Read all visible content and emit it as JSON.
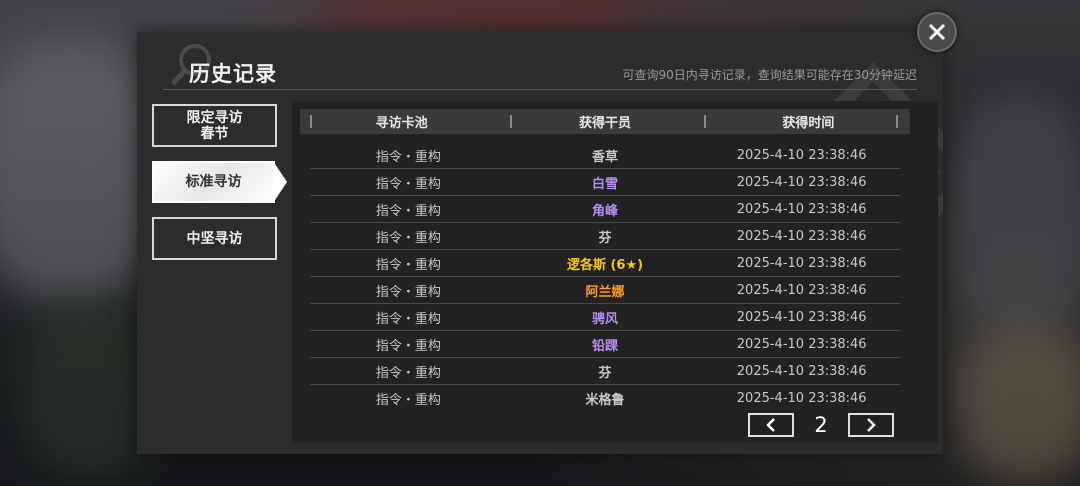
{
  "header": {
    "title": "历史记录",
    "subtitle": "可查询90日内寻访记录，查询结果可能存在30分钟延迟"
  },
  "tabs": [
    {
      "line1": "限定寻访",
      "line2": "春节",
      "active": false
    },
    {
      "label": "标准寻访",
      "active": true
    },
    {
      "label": "中坚寻访",
      "active": false
    }
  ],
  "table": {
    "columns": [
      "寻访卡池",
      "获得干员",
      "获得时间"
    ],
    "rows": [
      {
        "pool": "指令・重构",
        "operator": "香草",
        "time": "2025-4-10 23:38:46",
        "color": "#c8c8c8"
      },
      {
        "pool": "指令・重构",
        "operator": "白雪",
        "time": "2025-4-10 23:38:46",
        "color": "#b58cf0"
      },
      {
        "pool": "指令・重构",
        "operator": "角峰",
        "time": "2025-4-10 23:38:46",
        "color": "#b58cf0"
      },
      {
        "pool": "指令・重构",
        "operator": "芬",
        "time": "2025-4-10 23:38:46",
        "color": "#c8c8c8"
      },
      {
        "pool": "指令・重构",
        "operator": "逻各斯 (6★)",
        "time": "2025-4-10 23:38:46",
        "color": "#f5c518"
      },
      {
        "pool": "指令・重构",
        "operator": "阿兰娜",
        "time": "2025-4-10 23:38:46",
        "color": "#ff9a2a"
      },
      {
        "pool": "指令・重构",
        "operator": "骋风",
        "time": "2025-4-10 23:38:46",
        "color": "#b58cf0"
      },
      {
        "pool": "指令・重构",
        "operator": "铅踝",
        "time": "2025-4-10 23:38:46",
        "color": "#b58cf0"
      },
      {
        "pool": "指令・重构",
        "operator": "芬",
        "time": "2025-4-10 23:38:46",
        "color": "#c8c8c8"
      },
      {
        "pool": "指令・重构",
        "operator": "米格鲁",
        "time": "2025-4-10 23:38:46",
        "color": "#c8c8c8"
      }
    ]
  },
  "pager": {
    "page": "2"
  },
  "icons": {
    "close": "close-icon",
    "prev": "chevron-left-icon",
    "next": "chevron-right-icon",
    "watermark": "search-icon"
  }
}
